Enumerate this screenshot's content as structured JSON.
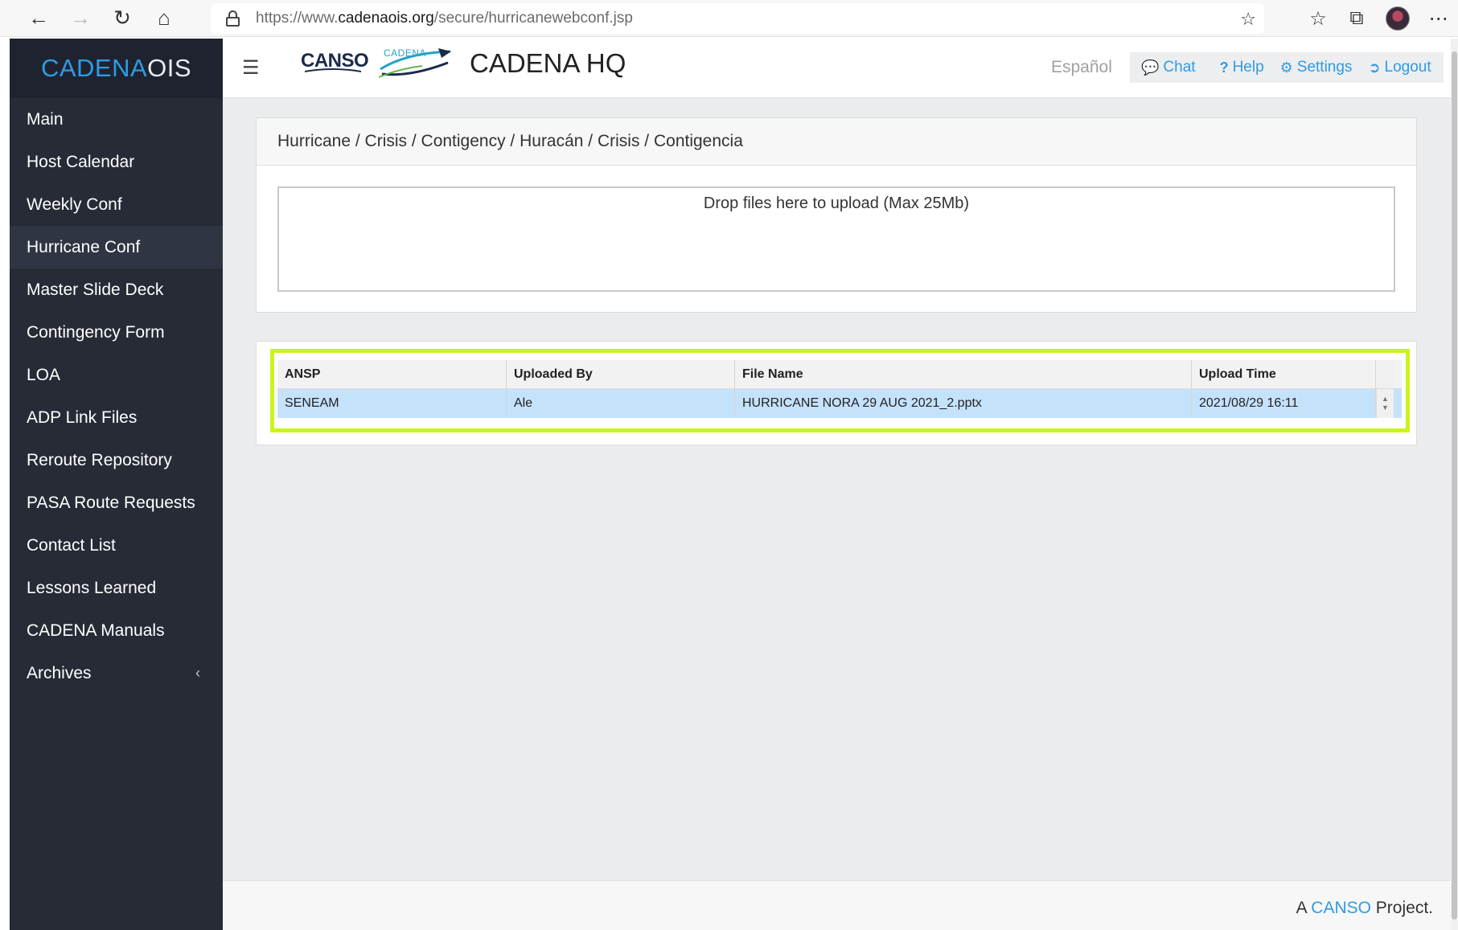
{
  "browser": {
    "url_prefix": "https://www.",
    "url_domain": "cadenaois.org",
    "url_path": "/secure/hurricanewebconf.jsp"
  },
  "brand": {
    "part1": "CADENA",
    "part2": "OIS"
  },
  "sidebar": {
    "items": [
      {
        "label": "Main"
      },
      {
        "label": "Host Calendar"
      },
      {
        "label": "Weekly Conf"
      },
      {
        "label": "Hurricane Conf"
      },
      {
        "label": "Master Slide Deck"
      },
      {
        "label": "Contingency Form"
      },
      {
        "label": "LOA"
      },
      {
        "label": "ADP Link Files"
      },
      {
        "label": "Reroute Repository"
      },
      {
        "label": "PASA Route Requests"
      },
      {
        "label": "Contact List"
      },
      {
        "label": "Lessons Learned"
      },
      {
        "label": "CADENA Manuals"
      },
      {
        "label": "Archives"
      }
    ],
    "archives_caret": "‹"
  },
  "header": {
    "canso_logo": "CANSO",
    "cadena_logo": "CADENA",
    "title": "CADENA HQ",
    "language": "Español",
    "chat": "Chat",
    "help": "Help",
    "settings": "Settings",
    "logout": "Logout"
  },
  "panel": {
    "title": "Hurricane / Crisis / Contigency / Huracán / Crisis / Contigencia",
    "dropzone": "Drop files here to upload (Max 25Mb)"
  },
  "table": {
    "columns": [
      "ANSP",
      "Uploaded By",
      "File Name",
      "Upload Time"
    ],
    "rows": [
      [
        "SENEAM",
        "Ale",
        "HURRICANE NORA 29 AUG 2021_2.pptx",
        "2021/08/29 16:11"
      ]
    ]
  },
  "footer": {
    "prefix": "A ",
    "link": "CANSO",
    "suffix": " Project."
  },
  "colors": {
    "accent": "#2e9be6",
    "sidebar": "#262b36",
    "highlight": "#c8f51b",
    "selected_row": "#c5e2fb"
  }
}
